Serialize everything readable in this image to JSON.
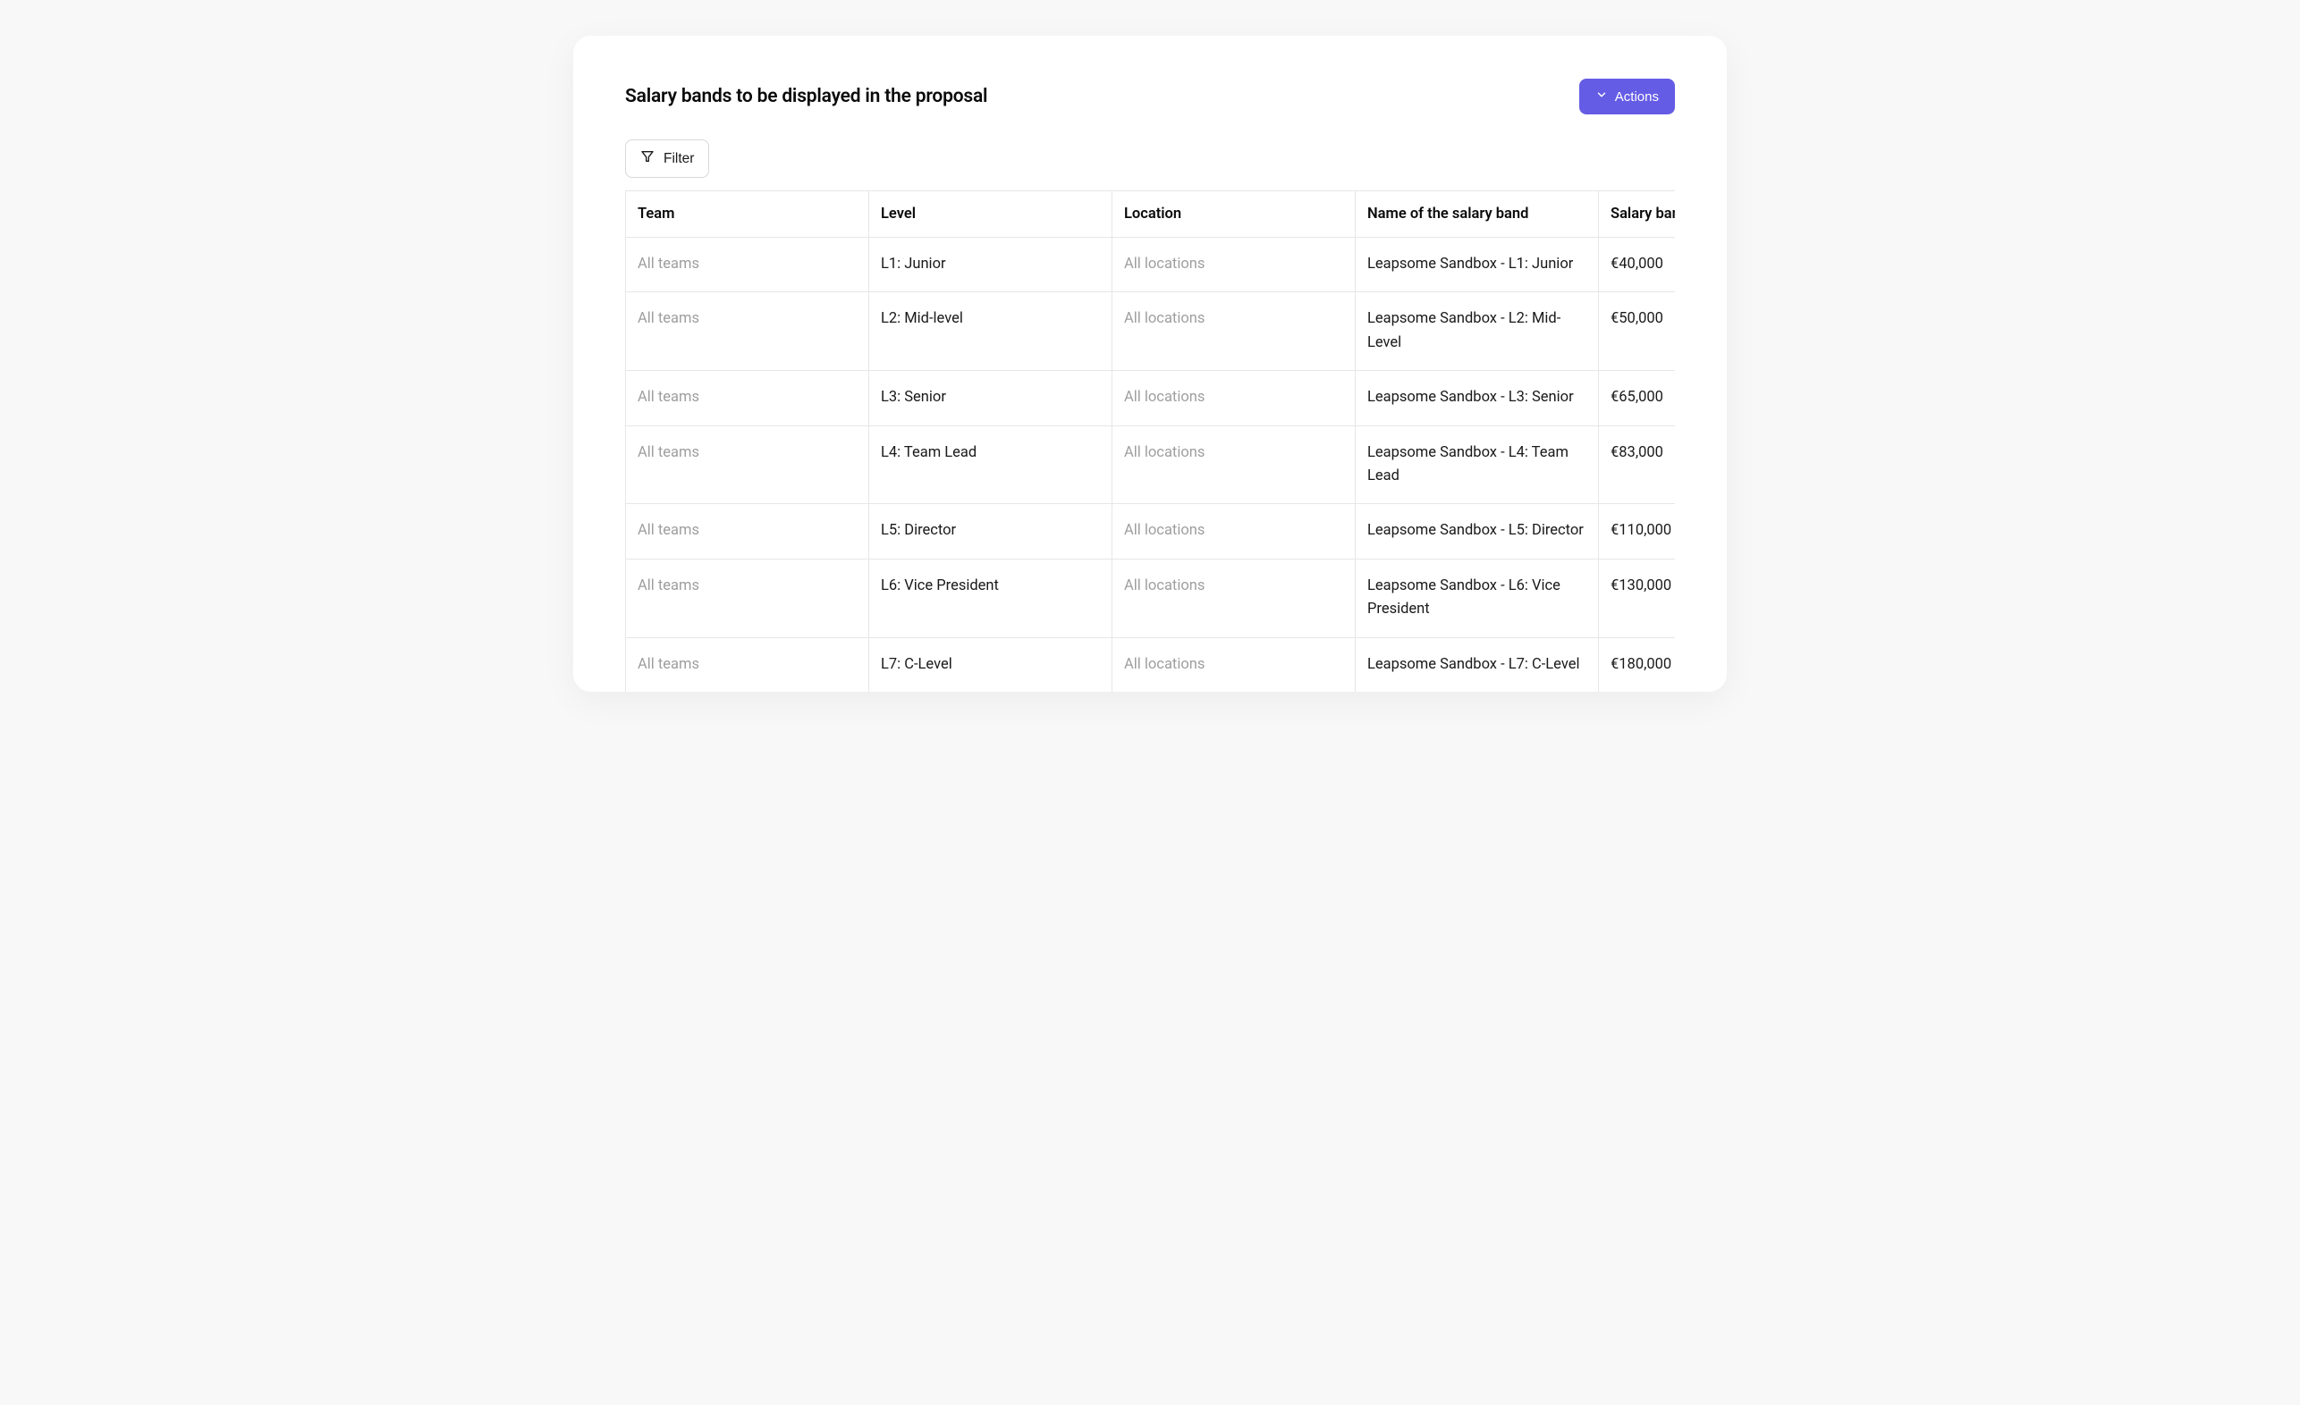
{
  "title": "Salary bands to be displayed in the proposal",
  "buttons": {
    "actions": "Actions",
    "filter": "Filter"
  },
  "table": {
    "columns": {
      "team": "Team",
      "level": "Level",
      "location": "Location",
      "name": "Name of the salary band",
      "salary_band": "Salary band"
    },
    "rows": [
      {
        "team": "All teams",
        "level": "L1: Junior",
        "location": "All locations",
        "name": "Leapsome Sandbox - L1: Junior",
        "salary": "€40,000"
      },
      {
        "team": "All teams",
        "level": "L2: Mid-level",
        "location": "All locations",
        "name": "Leapsome Sandbox - L2: Mid-Level",
        "salary": "€50,000"
      },
      {
        "team": "All teams",
        "level": "L3: Senior",
        "location": "All locations",
        "name": "Leapsome Sandbox - L3: Senior",
        "salary": "€65,000"
      },
      {
        "team": "All teams",
        "level": "L4: Team Lead",
        "location": "All locations",
        "name": "Leapsome Sandbox - L4: Team Lead",
        "salary": "€83,000"
      },
      {
        "team": "All teams",
        "level": "L5: Director",
        "location": "All locations",
        "name": "Leapsome Sandbox - L5: Director",
        "salary": "€110,000"
      },
      {
        "team": "All teams",
        "level": "L6: Vice President",
        "location": "All locations",
        "name": "Leapsome Sandbox - L6: Vice President",
        "salary": "€130,000"
      },
      {
        "team": "All teams",
        "level": "L7: C-Level",
        "location": "All locations",
        "name": "Leapsome Sandbox - L7: C-Level",
        "salary": "€180,000"
      }
    ]
  }
}
